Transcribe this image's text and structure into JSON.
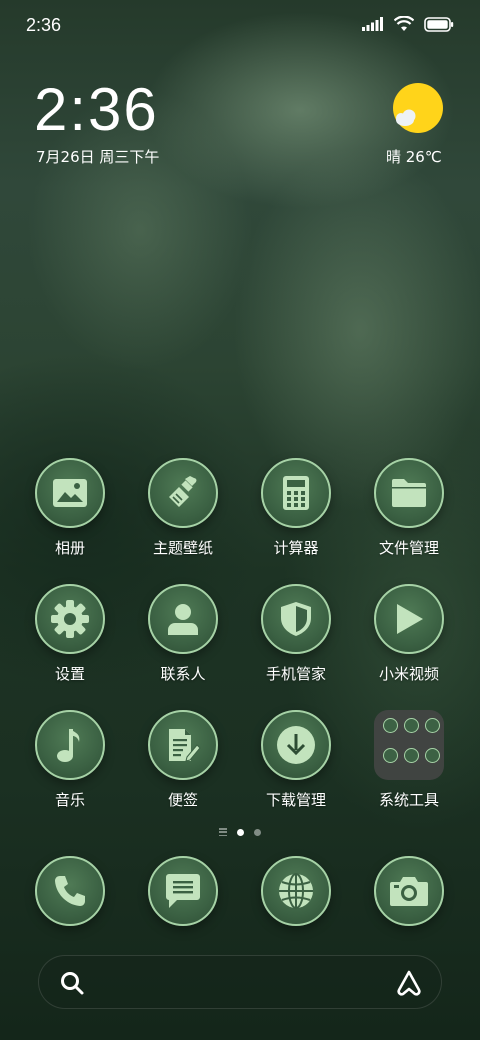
{
  "status_bar": {
    "time": "2:36"
  },
  "clock": {
    "time": "2:36",
    "date": "7月26日 周三下午"
  },
  "weather": {
    "text": "晴 26℃"
  },
  "apps": [
    {
      "label": "相册",
      "icon": "gallery-icon"
    },
    {
      "label": "主题壁纸",
      "icon": "brush-icon"
    },
    {
      "label": "计算器",
      "icon": "calculator-icon"
    },
    {
      "label": "文件管理",
      "icon": "folder-icon"
    },
    {
      "label": "设置",
      "icon": "gear-icon"
    },
    {
      "label": "联系人",
      "icon": "person-icon"
    },
    {
      "label": "手机管家",
      "icon": "shield-icon"
    },
    {
      "label": "小米视频",
      "icon": "play-icon"
    },
    {
      "label": "音乐",
      "icon": "music-note-icon"
    },
    {
      "label": "便签",
      "icon": "notes-icon"
    },
    {
      "label": "下载管理",
      "icon": "download-icon"
    },
    {
      "label": "系统工具",
      "icon": "folder-grid-icon"
    }
  ],
  "dock": [
    {
      "icon": "phone-icon"
    },
    {
      "icon": "message-icon"
    },
    {
      "icon": "globe-icon"
    },
    {
      "icon": "camera-icon"
    }
  ],
  "pager": {
    "pages": 2,
    "active": 1
  },
  "colors": {
    "icon_fill": "#3b6143",
    "icon_border": "#a6d2a6",
    "glyph": "#c2e3bd",
    "sun": "#ffd41a"
  }
}
